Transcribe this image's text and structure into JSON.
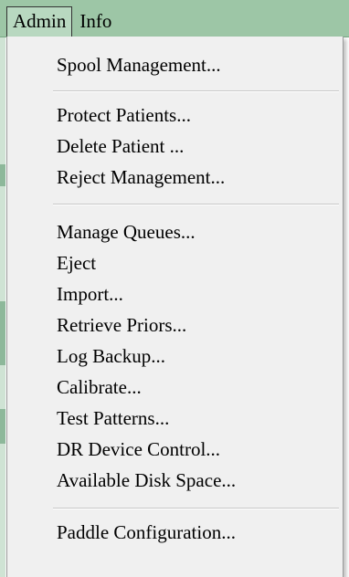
{
  "menubar": {
    "items": [
      {
        "label": "Admin"
      },
      {
        "label": "Info"
      }
    ]
  },
  "admin_menu": {
    "groups": [
      [
        "Spool Management..."
      ],
      [
        "Protect Patients...",
        "Delete Patient ...",
        "Reject Management..."
      ],
      [
        "Manage Queues...",
        "Eject",
        "Import...",
        "Retrieve Priors...",
        "Log Backup...",
        "Calibrate...",
        "Test Patterns...",
        "DR Device Control...",
        "Available Disk Space..."
      ],
      [
        "Paddle Configuration..."
      ]
    ]
  },
  "colors": {
    "menubar_bg": "#9dc6a6",
    "menubar_active_bg": "#b8d8c0",
    "menu_bg": "#f0f0f0",
    "separator": "#c8c8c8"
  }
}
